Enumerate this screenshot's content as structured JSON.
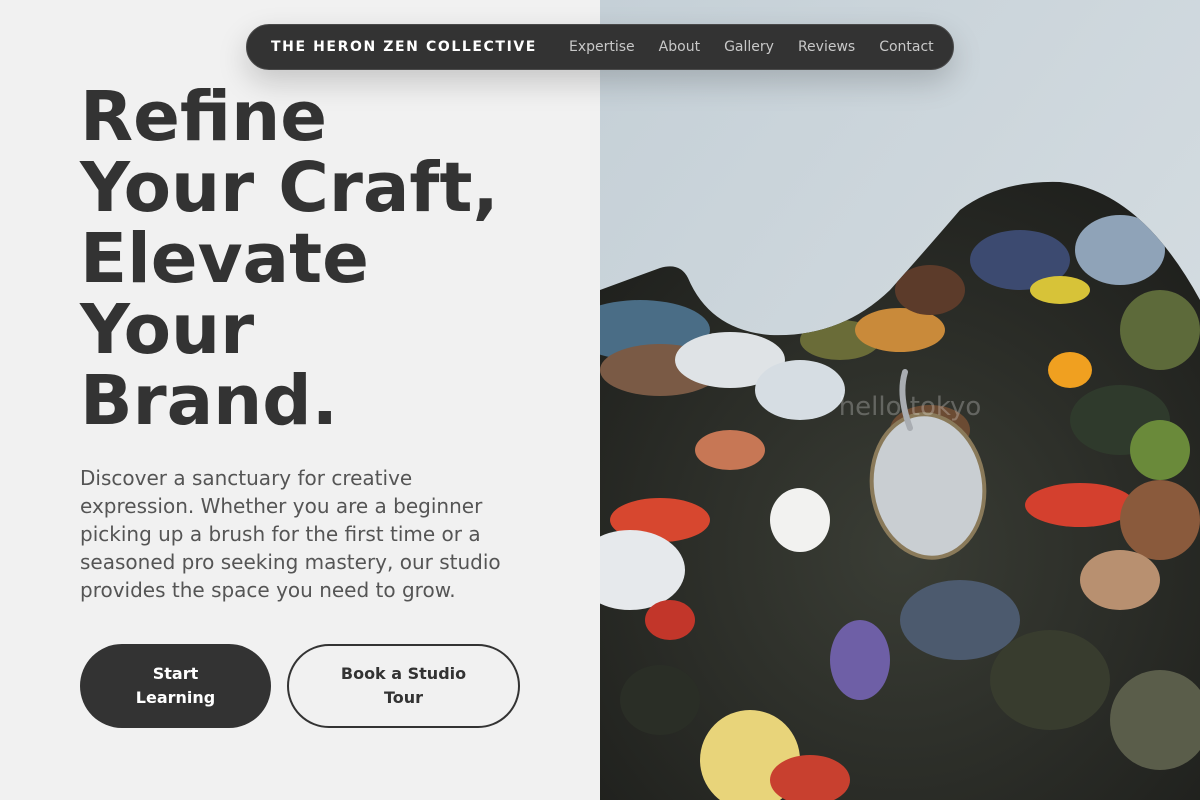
{
  "nav": {
    "brand": "THE HERON ZEN COLLECTIVE",
    "links": [
      "Expertise",
      "About",
      "Gallery",
      "Reviews",
      "Contact"
    ]
  },
  "hero": {
    "headline_lines": [
      "Refine",
      "Your Craft,",
      "Elevate",
      "Your",
      "Brand."
    ],
    "description": "Discover a sanctuary for creative expression. Whether you are a beginner picking up a brush for the first time or a seasoned pro seeking mastery, our studio provides the space you need to grow.",
    "primary_button": "Start Learning",
    "secondary_button": "Book a Studio Tour"
  },
  "image": {
    "subject": "paint-palette-photo",
    "watermark": "hello tokyo"
  },
  "colors": {
    "text_dark": "#333333",
    "text_muted": "#555555",
    "background": "#f1f1f1",
    "nav_background": "#333333"
  }
}
